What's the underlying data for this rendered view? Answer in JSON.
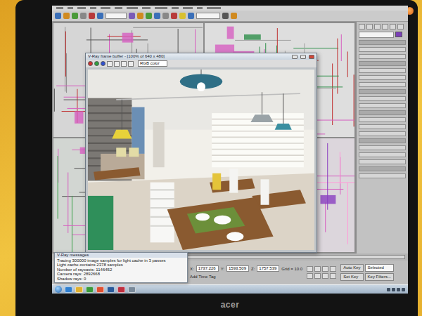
{
  "frame_buffer": {
    "title": "V-Ray frame buffer - [100% of 640 x 480]",
    "channel": "RGB color"
  },
  "messages": {
    "title": "V-Ray messages",
    "lines": [
      "Tracing 300000 image samples for light cache in 3 passes",
      "Light cache contains 2378 samples",
      "Number of raycasts: 1146452",
      "Camera rays: 2892668",
      "Shadow rays: 0"
    ]
  },
  "status": {
    "coordinates": [
      {
        "label": "X:",
        "value": "1737.226"
      },
      {
        "label": "Y:",
        "value": "1593.509"
      },
      {
        "label": "Z:",
        "value": "1757.539"
      }
    ],
    "grid": "Grid = 10.0",
    "time_tag": "Add Time Tag"
  },
  "animation_controls": {
    "auto_key": "Auto Key",
    "key_mode": "Selected",
    "set_key": "Set Key",
    "key_filters": "Key Filters..."
  },
  "monitor": {
    "brand": "acer"
  }
}
